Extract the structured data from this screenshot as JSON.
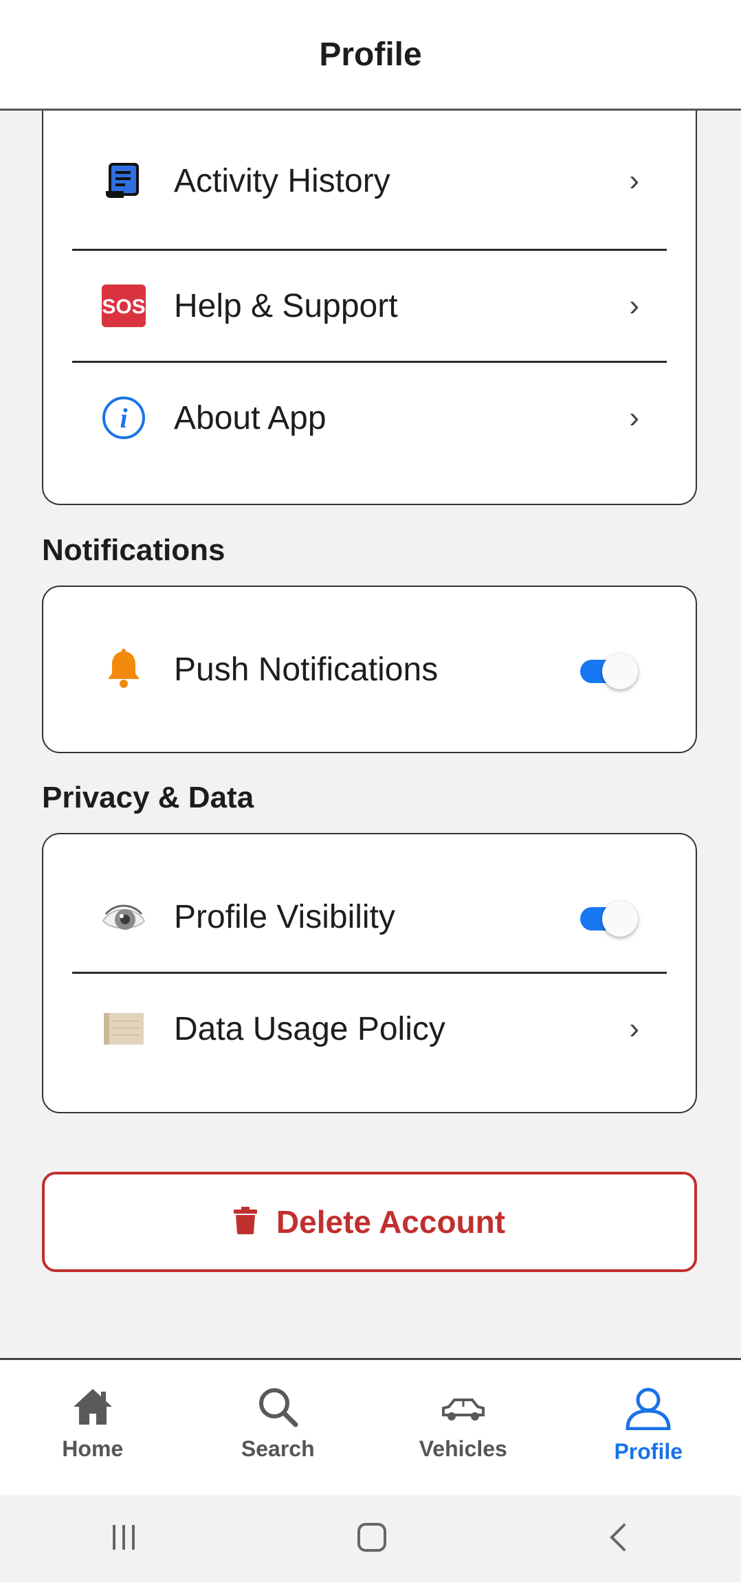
{
  "header": {
    "title": "Profile"
  },
  "account_menu": {
    "items": [
      {
        "label": "Activity History",
        "icon": "receipt-icon",
        "chevron": "›"
      },
      {
        "label": "Help & Support",
        "icon": "sos-icon",
        "icon_text": "SOS",
        "chevron": "›"
      },
      {
        "label": "About App",
        "icon": "info-icon",
        "chevron": "›"
      }
    ]
  },
  "notifications": {
    "title": "Notifications",
    "items": [
      {
        "label": "Push Notifications",
        "icon": "bell-icon",
        "enabled": true
      }
    ]
  },
  "privacy": {
    "title": "Privacy & Data",
    "items": [
      {
        "label": "Profile Visibility",
        "icon": "eye-icon",
        "enabled": true
      },
      {
        "label": "Data Usage Policy",
        "icon": "scroll-icon",
        "chevron": "›"
      }
    ]
  },
  "delete_account": {
    "label": "Delete Account",
    "color": "#c0302e"
  },
  "tabbar": {
    "active": "Profile",
    "active_color": "#1a73e8",
    "tabs": [
      {
        "label": "Home",
        "icon": "home-icon"
      },
      {
        "label": "Search",
        "icon": "search-icon"
      },
      {
        "label": "Vehicles",
        "icon": "car-icon"
      },
      {
        "label": "Profile",
        "icon": "person-icon"
      }
    ]
  },
  "colors": {
    "toggle_on": "#1877f2",
    "sos_red": "#d9333f",
    "bell_orange": "#f28a0c",
    "info_blue": "#1a73e8"
  }
}
